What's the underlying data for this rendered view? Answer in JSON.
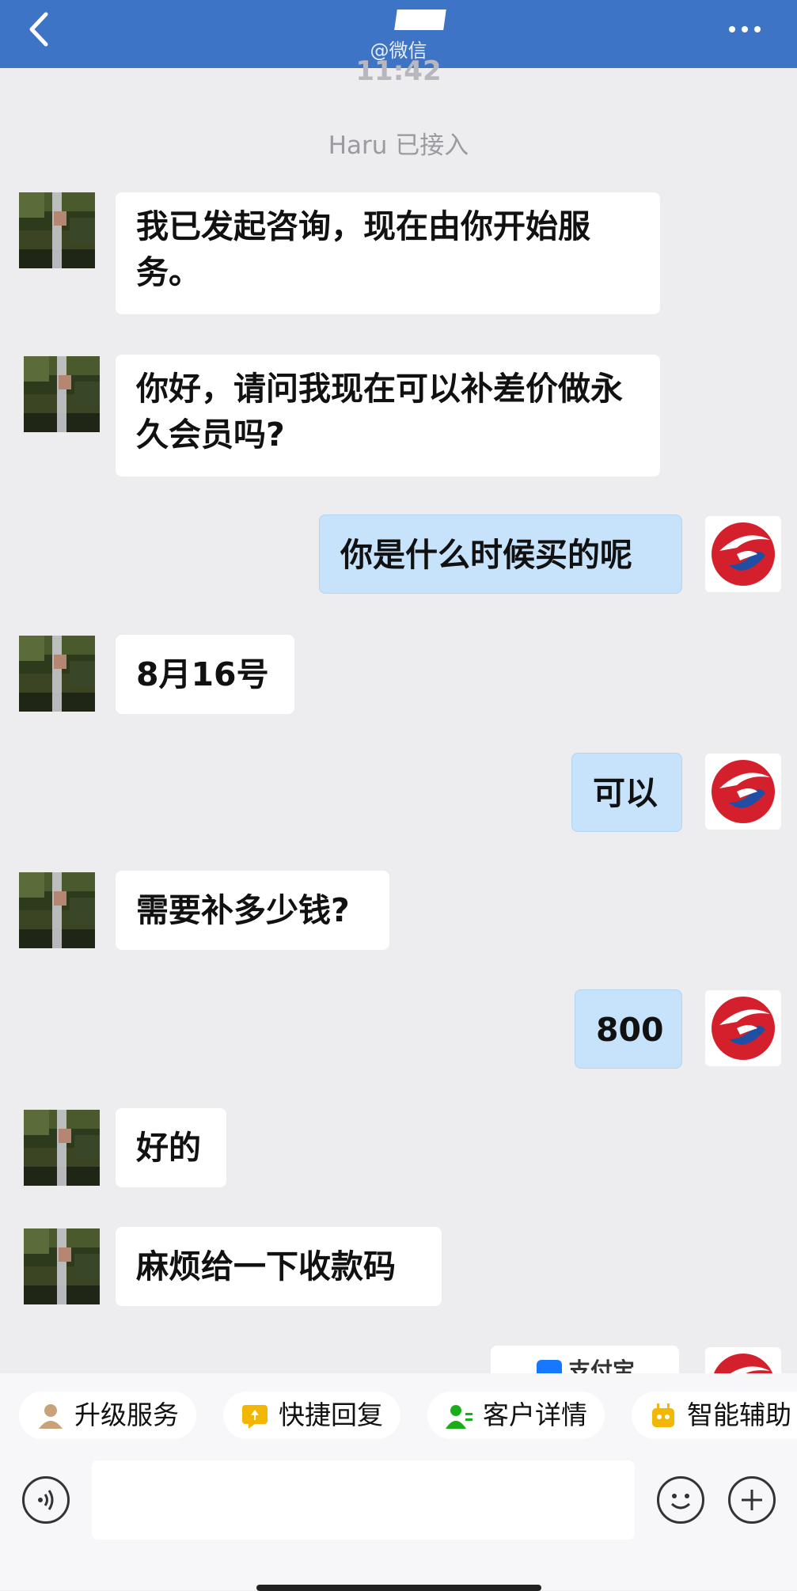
{
  "header": {
    "subtitle": "@微信",
    "back_icon": "chevron-left-icon",
    "more_icon": "more-horizontal-icon"
  },
  "chat": {
    "time": "11:42",
    "system_notice": "Haru 已接入",
    "messages": [
      {
        "from": "customer",
        "text": "我已发起咨询，现在由你开始服务。"
      },
      {
        "from": "customer",
        "text": "你好，请问我现在可以补差价做永久会员吗?"
      },
      {
        "from": "agent",
        "text": "你是什么时候买的呢"
      },
      {
        "from": "customer",
        "text": "8月16号"
      },
      {
        "from": "agent",
        "text": "可以"
      },
      {
        "from": "customer",
        "text": "需要补多少钱?"
      },
      {
        "from": "agent",
        "text": "800"
      },
      {
        "from": "customer",
        "text": "好的"
      },
      {
        "from": "customer",
        "text": "麻烦给一下收款码"
      },
      {
        "from": "agent",
        "text": "支付宝"
      }
    ]
  },
  "quick_actions": [
    {
      "label": "升级服务",
      "icon": "user-upgrade-icon",
      "color": "#c9a27a"
    },
    {
      "label": "快捷回复",
      "icon": "quick-reply-icon",
      "color": "#f2b705"
    },
    {
      "label": "客户详情",
      "icon": "customer-detail-icon",
      "color": "#1aad19"
    },
    {
      "label": "智能辅助",
      "icon": "smart-assist-icon",
      "color": "#f2b705"
    }
  ],
  "input": {
    "placeholder": "",
    "voice_icon": "voice-icon",
    "emoji_icon": "emoji-icon",
    "plus_icon": "plus-icon"
  },
  "colors": {
    "header_bg": "#3d74c6",
    "chat_bg": "#ededf0",
    "outgoing_bubble": "#c7e3fb",
    "incoming_bubble": "#ffffff",
    "agent_logo_red": "#d4202c",
    "agent_logo_blue": "#1f4ea3"
  }
}
